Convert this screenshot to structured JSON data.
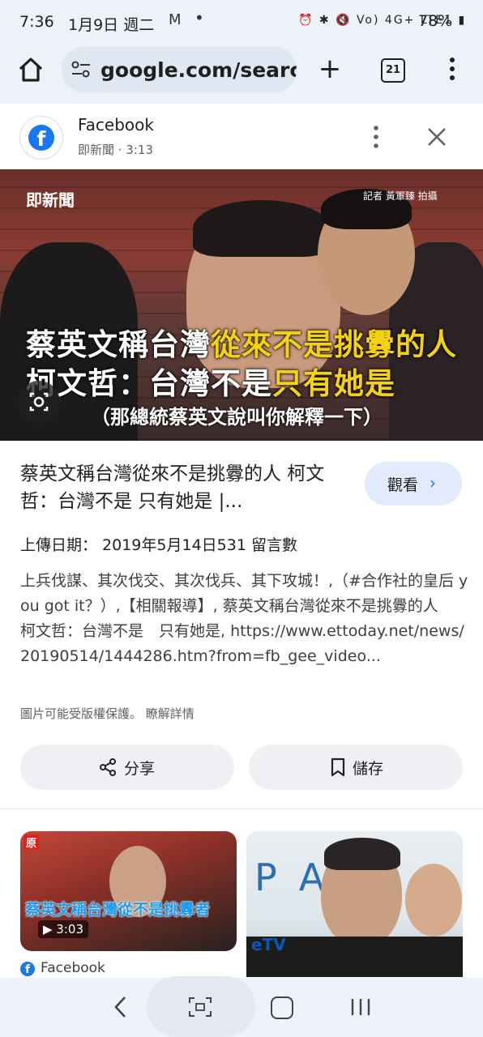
{
  "status_bar": {
    "time": "7:36",
    "date": "1月9日 週二",
    "icons_text": "⏰ ✱ 🔇 Vo) 4G+ LTE1 ▮",
    "battery": "78%"
  },
  "browser": {
    "url": "google.com/searcl",
    "tab_count": "21"
  },
  "result": {
    "source_name": "Facebook",
    "source_meta": "即新聞 · 3:13",
    "hero": {
      "logo": "即新聞",
      "credit": "記者 黃軍臻 拍攝",
      "caption_line1_a": "蔡英文稱台灣",
      "caption_line1_b": "從來不是挑釁的人",
      "caption_line2_a": "柯文哲：台灣不是",
      "caption_line2_b": "只有她是",
      "caption_line3": "（那總統蔡英文說叫你解釋一下）"
    },
    "title": "蔡英文稱台灣從來不是挑釁的人 柯文哲：台灣不是 只有她是 |...",
    "watch_label": "觀看",
    "upload": "上傳日期： 2019年5月14日531 留言數",
    "description": "上兵伐謀、其次伐交、其次伐兵、其下攻城！,（#合作社的皇后 you got it？）,【相關報導】, 蔡英文稱台灣從來不是挑釁的人　 柯文哲：台灣不是　只有她是, https://www.ettoday.net/news/20190514/1444286.htm?from=fb_gee_video...",
    "copyright": "圖片可能受版權保護。 瞭解詳情",
    "share_label": "分享",
    "save_label": "儲存"
  },
  "related": {
    "card1": {
      "tag": "原",
      "caption": "蔡英文稱台灣從不是挑釁者",
      "duration": "▶ 3:03",
      "source": "Facebook"
    },
    "card2": {
      "bg_text": "PAI",
      "logo": "eTV"
    }
  },
  "colors": {
    "accent_blue": "#1a73e8",
    "facebook_blue": "#1877f2",
    "caption_yellow": "#f5d20f"
  }
}
